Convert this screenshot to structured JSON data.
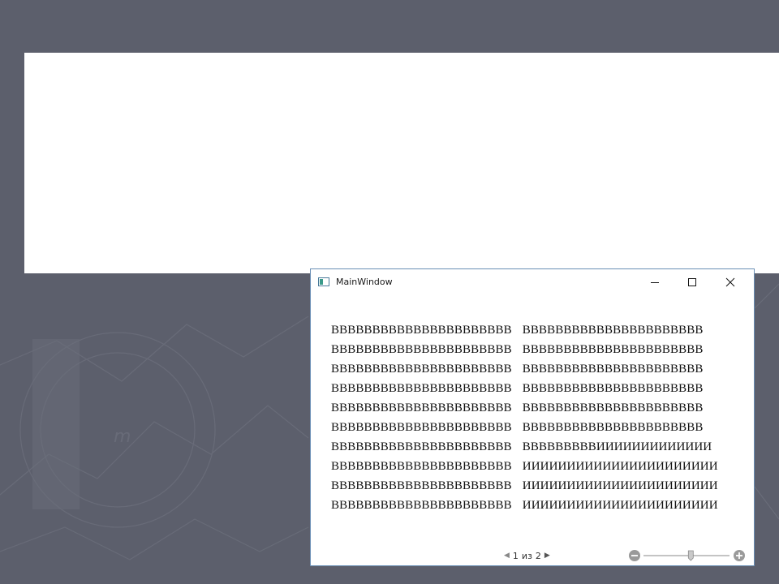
{
  "window": {
    "title": "MainWindow",
    "controls": {
      "minimize": "minimize-icon",
      "maximize": "maximize-icon",
      "close": "close-icon"
    }
  },
  "document": {
    "columns": [
      {
        "lines": [
          "BBBBBBBBBBBBBBBBBBBBBB",
          "BBBBBBBBBBBBBBBBBBBBBB",
          "BBBBBBBBBBBBBBBBBBBBBB",
          "BBBBBBBBBBBBBBBBBBBBBB",
          "BBBBBBBBBBBBBBBBBBBBBB",
          "BBBBBBBBBBBBBBBBBBBBBB",
          "BBBBBBBBBBBBBBBBBBBBBB",
          "BBBBBBBBBBBBBBBBBBBBBB",
          "BBBBBBBBBBBBBBBBBBBBBB",
          "BBBBBBBBBBBBBBBBBBBBBB"
        ]
      },
      {
        "lines": [
          "BBBBBBBBBBBBBBBBBBBBBB",
          "BBBBBBBBBBBBBBBBBBBBBB",
          "BBBBBBBBBBBBBBBBBBBBBB",
          "BBBBBBBBBBBBBBBBBBBBBB",
          "BBBBBBBBBBBBBBBBBBBBBB",
          "BBBBBBBBBBBBBBBBBBBBBB",
          "BBBBBBBBBИИИИИИИИИИИИИ",
          "ИИИИИИИИИИИИИИИИИИИИИИ",
          "ИИИИИИИИИИИИИИИИИИИИИИ",
          "ИИИИИИИИИИИИИИИИИИИИИИ"
        ]
      }
    ]
  },
  "pager": {
    "current": "1",
    "separator": "из",
    "total": "2"
  },
  "zoom": {
    "level": 0.55
  },
  "colors": {
    "desktop": "#5c5f6c",
    "window_border": "#6a8fb5",
    "text": "#111111"
  }
}
